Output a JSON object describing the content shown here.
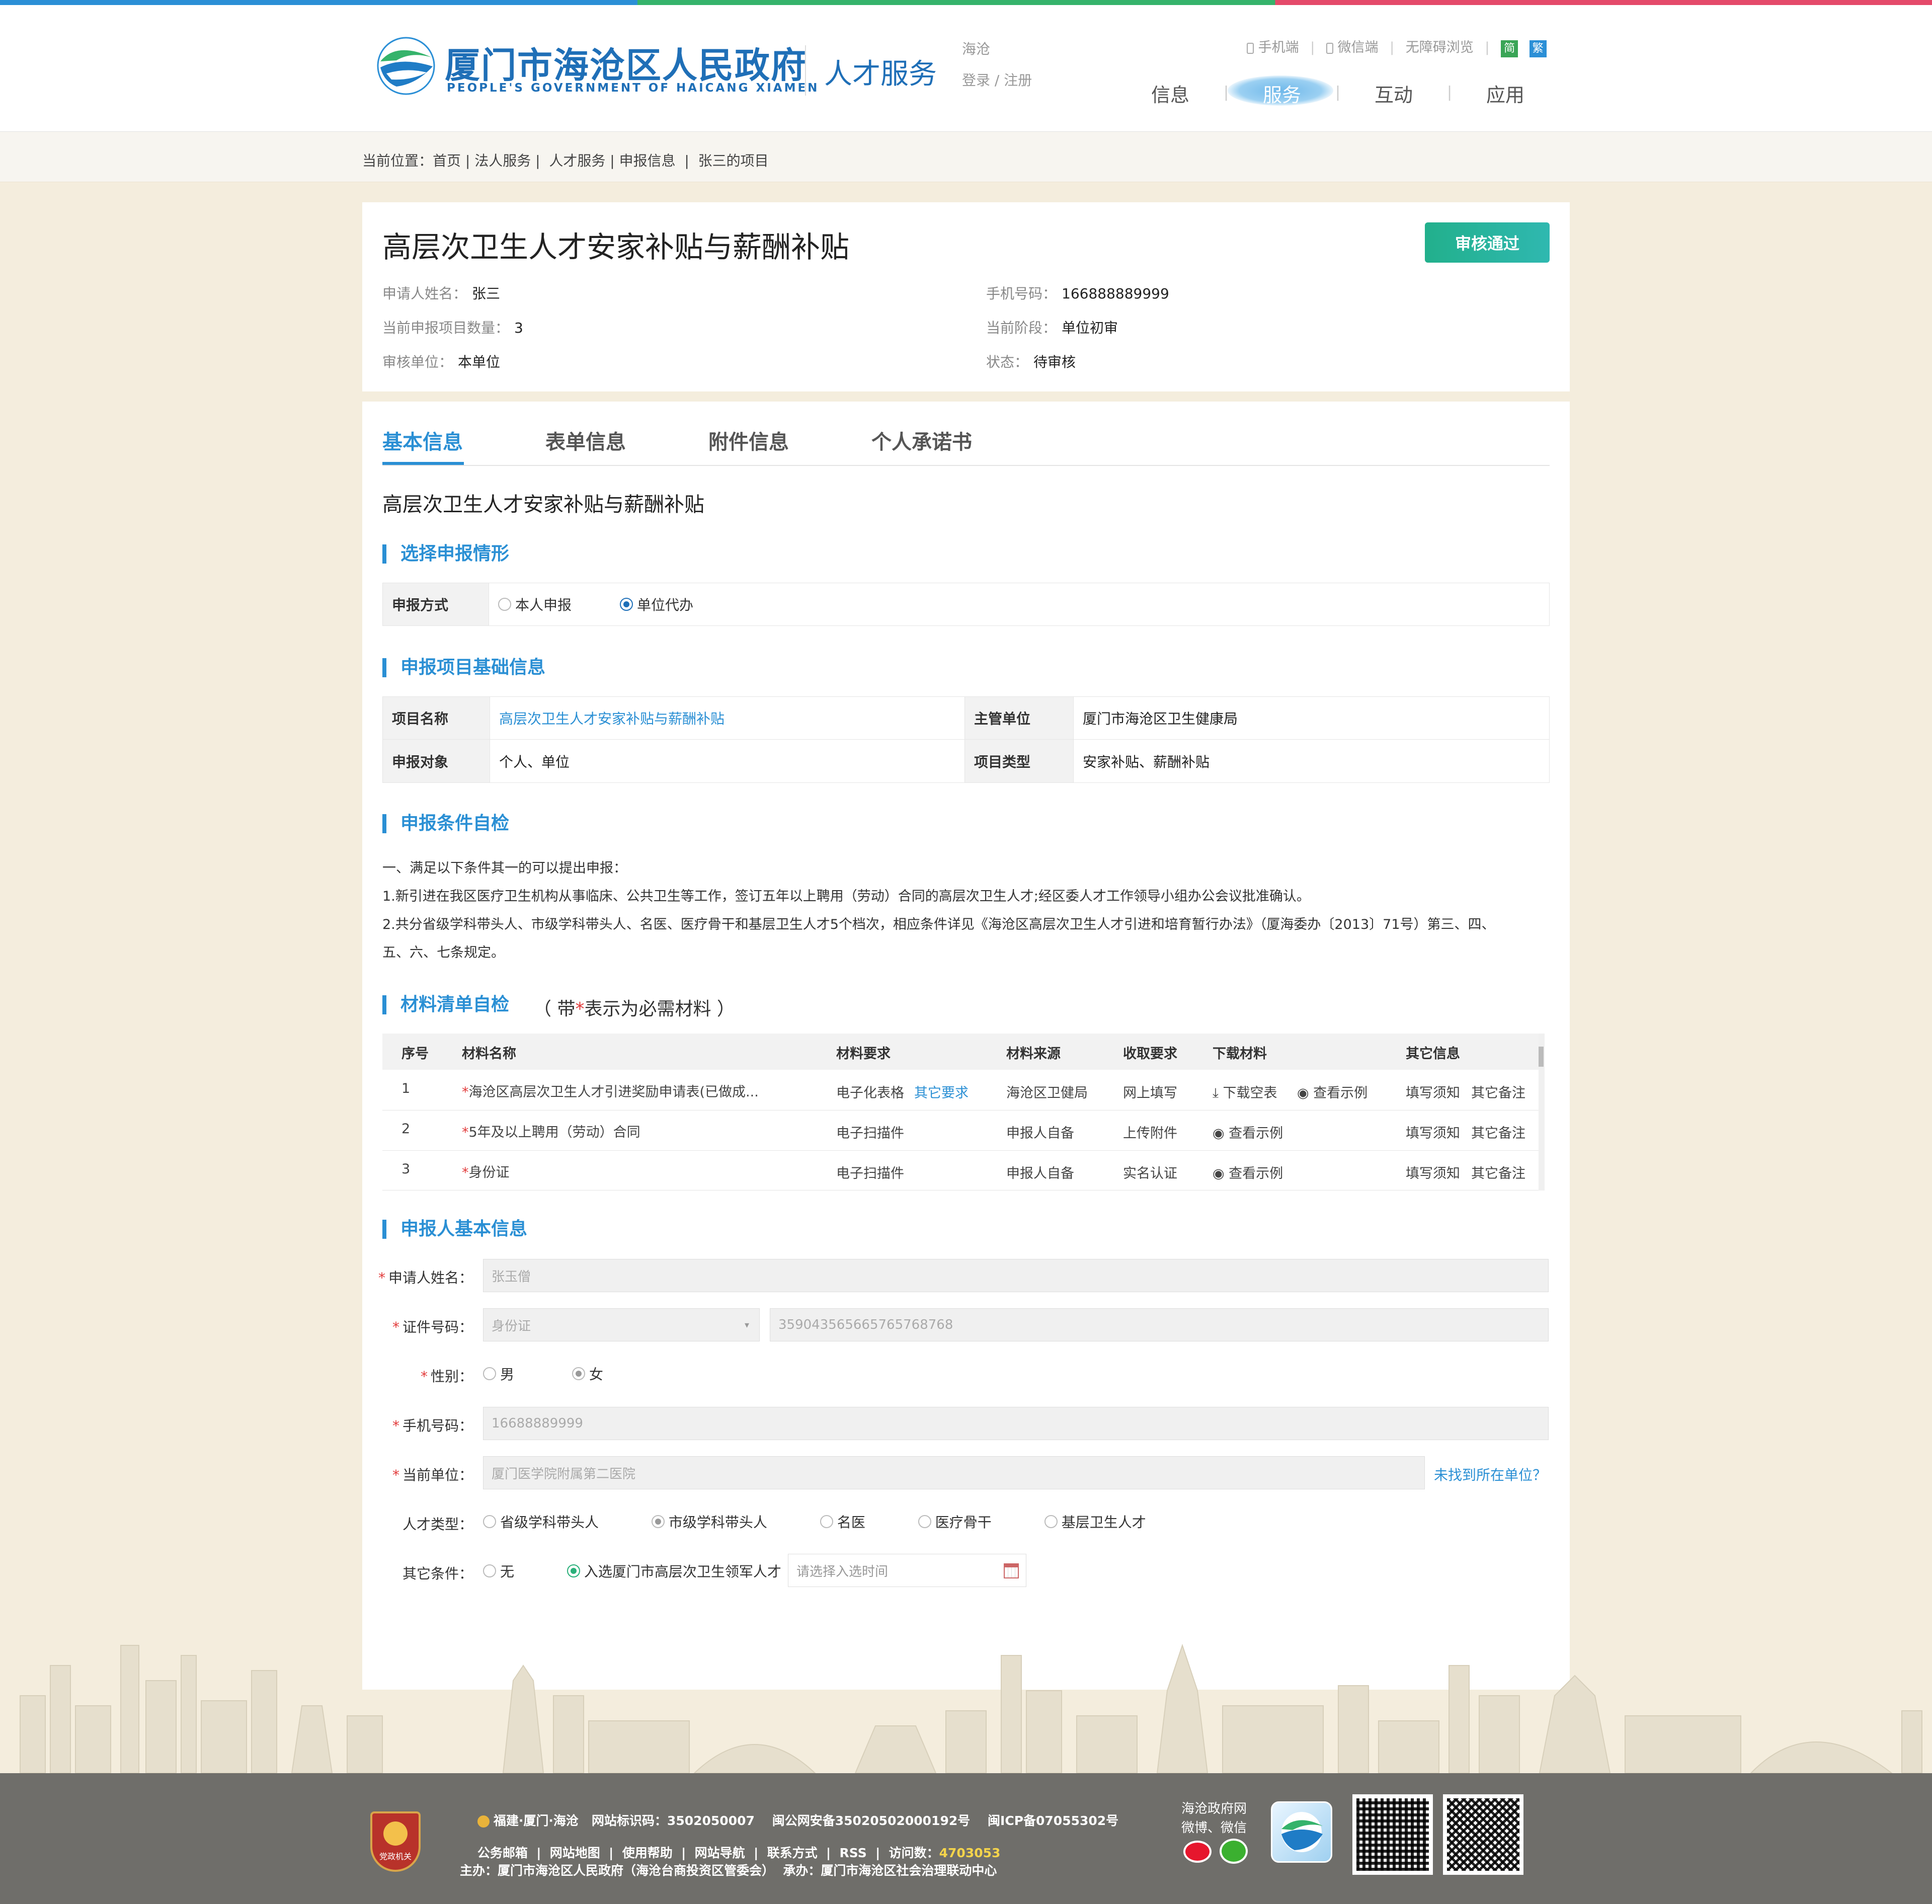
{
  "header": {
    "site_title": "厦门市海沧区人民政府",
    "site_subtitle": "PEOPLE'S GOVERNMENT OF HAICANG XIAMEN",
    "channel": "人才服务",
    "region": "海沧",
    "login": "登录",
    "register": "注册",
    "login_sep": "/",
    "links": [
      "手机端",
      "微信端",
      "无障碍浏览"
    ],
    "lang_simple": "简",
    "lang_trad": "繁",
    "nav": [
      "信息",
      "服务",
      "互动",
      "应用"
    ],
    "nav_active": 1
  },
  "breadcrumb": {
    "text": "当前位置：首页 | 法人服务 |  人才服务 | 申报信息  |  张三的项目"
  },
  "summary": {
    "title": "高层次卫生人才安家补贴与薪酬补贴",
    "approve_button": "审核通过",
    "left": [
      {
        "label": "申请人姓名：",
        "value": "张三"
      },
      {
        "label": "当前申报项目数量：",
        "value": "3"
      },
      {
        "label": "审核单位：",
        "value": "本单位"
      }
    ],
    "right": [
      {
        "label": "手机号码：",
        "value": "166888889999"
      },
      {
        "label": "当前阶段：",
        "value": "单位初审"
      },
      {
        "label": "状态：",
        "value": "待审核"
      }
    ]
  },
  "tabs": [
    "基本信息",
    "表单信息",
    "附件信息",
    "个人承诺书"
  ],
  "active_tab": 0,
  "project_heading": "高层次卫生人才安家补贴与薪酬补贴",
  "section1": {
    "title": "选择申报情形",
    "label": "申报方式",
    "options": [
      "本人申报",
      "单位代办"
    ],
    "selected": 1
  },
  "section2": {
    "title": "申报项目基础信息",
    "rows": [
      {
        "l1": "项目名称",
        "v1": "高层次卫生人才安家补贴与薪酬补贴",
        "l2": "主管单位",
        "v2": "厦门市海沧区卫生健康局"
      },
      {
        "l1": "申报对象",
        "v1": "个人、单位",
        "l2": "项目类型",
        "v2": "安家补贴、薪酬补贴"
      }
    ]
  },
  "section3": {
    "title": "申报条件自检",
    "lines": [
      "一、满足以下条件其一的可以提出申报：",
      "1.新引进在我区医疗卫生机构从事临床、公共卫生等工作，签订五年以上聘用（劳动）合同的高层次卫生人才;经区委人才工作领导小组办公会议批准确认。",
      "2.共分省级学科带头人、市级学科带头人、名医、医疗骨干和基层卫生人才5个档次，相应条件详见《海沧区高层次卫生人才引进和培育暂行办法》（厦海委办〔2013〕71号）第三、四、",
      "五、六、七条规定。"
    ]
  },
  "section4": {
    "title": "材料清单自检",
    "note_pre": "（ 带",
    "note_star": "*",
    "note_post": "表示为必需材料 ）",
    "headers": [
      "序号",
      "材料名称",
      "材料要求",
      "材料来源",
      "收取要求",
      "下载材料",
      "其它信息"
    ],
    "rows": [
      {
        "no": "1",
        "name": "海沧区高层次卫生人才引进奖励申请表(已做成...",
        "req": "电子化表格",
        "req_link": "其它要求",
        "source": "海沧区卫健局",
        "collect": "网上填写",
        "dl1": "下载空表",
        "dl2": "查看示例",
        "o1": "填写须知",
        "o2": "其它备注"
      },
      {
        "no": "2",
        "name": "5年及以上聘用（劳动）合同",
        "req": "电子扫描件",
        "req_link": "",
        "source": "申报人自备",
        "collect": "上传附件",
        "dl1": "",
        "dl2": "查看示例",
        "o1": "填写须知",
        "o2": "其它备注"
      },
      {
        "no": "3",
        "name": "身份证",
        "req": "电子扫描件",
        "req_link": "",
        "source": "申报人自备",
        "collect": "实名认证",
        "dl1": "",
        "dl2": "查看示例",
        "o1": "填写须知",
        "o2": "其它备注"
      }
    ]
  },
  "section5": {
    "title": "申报人基本信息",
    "name_label": "申请人姓名：",
    "name_value": "张玉僧",
    "id_label": "证件号码：",
    "id_type": "身份证",
    "id_value": "35904356566576576876​8",
    "gender_label": "性别：",
    "gender_options": [
      "男",
      "女"
    ],
    "gender_selected": 1,
    "phone_label": "手机号码：",
    "phone_value": "16688889999",
    "unit_label": "当前单位：",
    "unit_value": "厦门医学院附属第二医院",
    "unit_link": "未找到所在单位？",
    "talent_label": "人才类型：",
    "talent_options": [
      "省级学科带头人",
      "市级学科带头人",
      "名医",
      "医疗骨干",
      "基层卫生人才"
    ],
    "talent_selected": 1,
    "other_label": "其它条件：",
    "other_options": [
      "无",
      "入选厦门市高层次卫生领军人才"
    ],
    "other_selected": 1,
    "date_placeholder": "请选择入选时间"
  },
  "footer": {
    "line1": "福建·厦门·海沧   网站标识码：3502050007    闽公网安备35020502000192号    闽ICP备07055302号",
    "line2_pre": "公务邮箱  |  网站地图  |  使用帮助  |  网站导航  |  联系方式  |  RSS  |  访问数：",
    "visits": "4703053",
    "line3": "主办：厦门市海沧区人民政府（海沧台商投资区管委会）  承办：厦门市海沧区社会治理联动中心",
    "social1": "海沧政府网",
    "social2": "微博、微信",
    "badge": "党政机关"
  },
  "colors": {
    "accent": "#2a8fd4",
    "approve": "#27b39a",
    "required": "#e23b3b",
    "footer_bg": "#6f6e6a"
  }
}
